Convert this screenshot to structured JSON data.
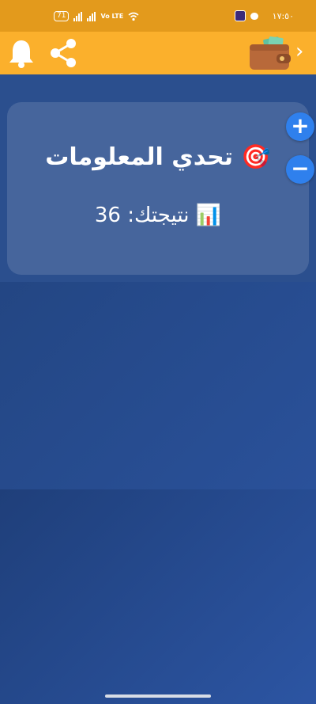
{
  "status_bar": {
    "battery": "71",
    "network": "Vo LTE",
    "time": "١٧:٥٠"
  },
  "toolbar": {
    "left_icons": [
      "bell-icon",
      "share-icon"
    ],
    "right_icons": [
      "wallet-icon",
      "chevron-right-icon"
    ]
  },
  "card": {
    "title": "🎯 تحدي المعلومات",
    "score": "📊 نتيجتك: 36"
  },
  "fab": {
    "plus": "+",
    "minus": "−"
  },
  "colors": {
    "status_bar": "#e39a1c",
    "toolbar": "#fbb02c",
    "background": "#2b4f8e",
    "fab": "#2f80ed"
  }
}
